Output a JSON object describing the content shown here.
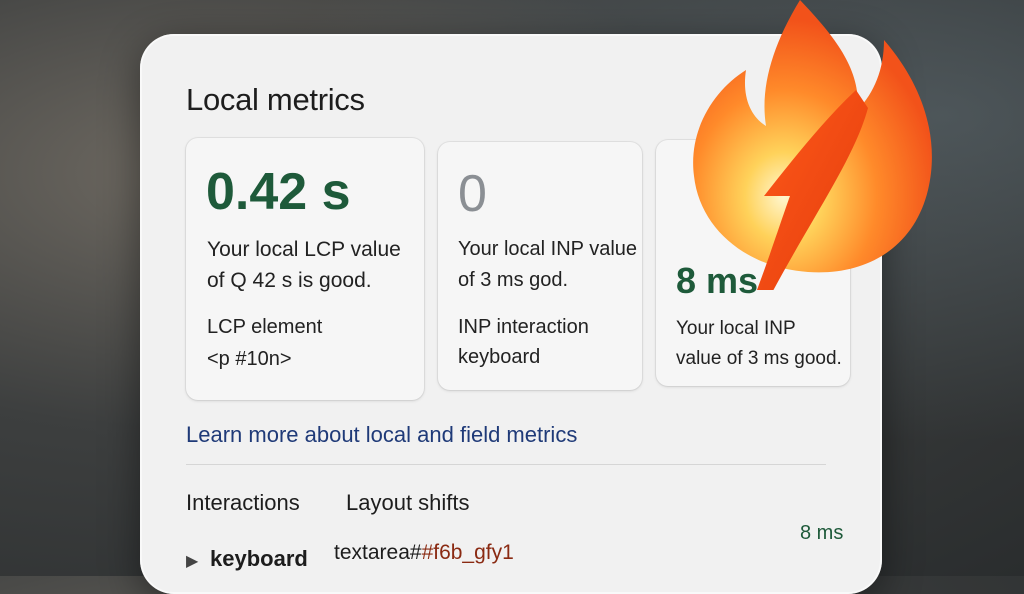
{
  "panel": {
    "title": "Local metrics",
    "cards": [
      {
        "value": "0.42 s",
        "description": "Your local LCP value of Q 42 s is good.",
        "label": "LCP element",
        "detail": "<p #10n>"
      },
      {
        "value": "0",
        "description": "Your local INP value of 3 ms god.",
        "label": "INP interaction",
        "detail": "keyboard"
      },
      {
        "value": "8 ms",
        "description": "Your local INP value of 3 ms good."
      }
    ],
    "learn_more_link": "Learn more about local and field metrics",
    "tabs": [
      "Interactions",
      "Layout shifts"
    ],
    "interaction_row": {
      "label": "keyboard",
      "target_element": "textarea#",
      "target_id": "#f6b_gfy1",
      "value": "8 ms"
    }
  },
  "icons": {
    "flame": "flame-icon",
    "arrow": "arrow-icon",
    "caret": "caret-right-icon"
  },
  "colors": {
    "good": "#1e5a3a",
    "link": "#1f3a78",
    "flame": "#ff6a1a"
  }
}
